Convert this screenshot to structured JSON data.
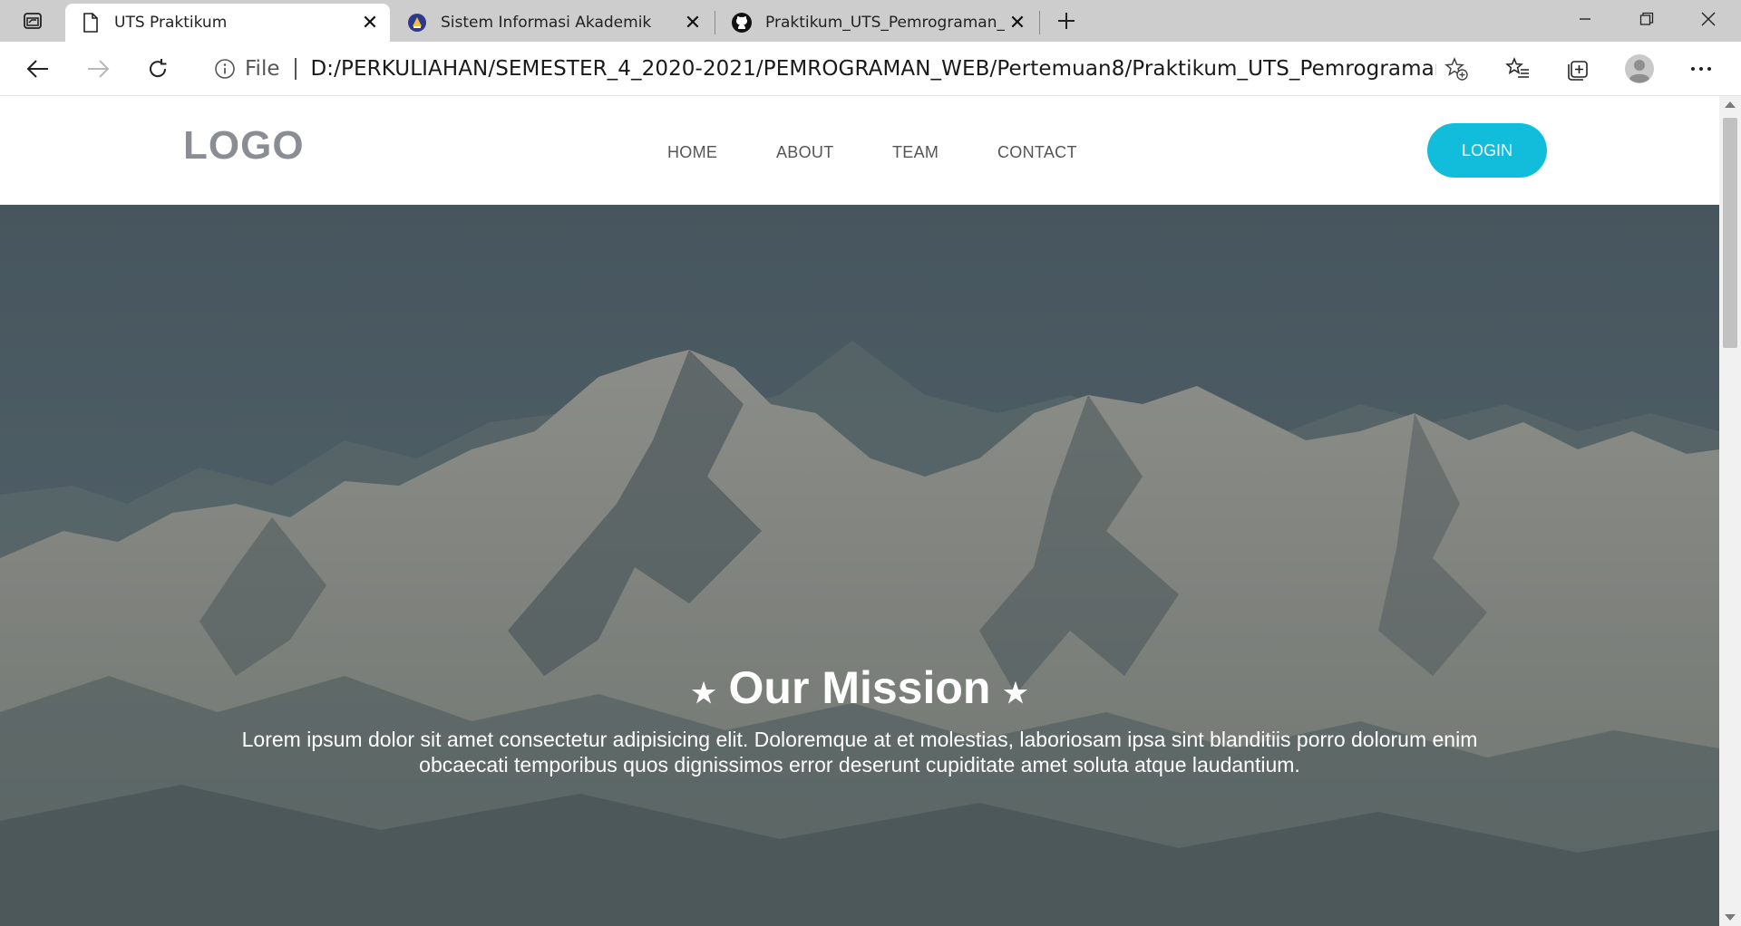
{
  "browser": {
    "tabs": [
      {
        "title": "UTS Praktikum",
        "active": true,
        "icon": "page-icon"
      },
      {
        "title": "Sistem Informasi Akademik",
        "active": false,
        "icon": "university-crest-icon"
      },
      {
        "title": "Praktikum_UTS_Pemrograman_W",
        "active": false,
        "icon": "github-icon"
      }
    ],
    "address": {
      "scheme": "File",
      "url": "D:/PERKULIAHAN/SEMESTER_4_2020-2021/PEMROGRAMAN_WEB/Pertemuan8/Praktikum_UTS_Pemrograman_W..."
    }
  },
  "page": {
    "logo": "LOGO",
    "nav": {
      "home": "HOME",
      "about": "ABOUT",
      "team": "TEAM",
      "contact": "CONTACT"
    },
    "login_label": "LOGIN",
    "hero": {
      "title": "Our Mission",
      "star": "★",
      "text": "Lorem ipsum dolor sit amet consectetur adipisicing elit. Doloremque at et molestias, laboriosam ipsa sint blanditiis porro dolorum enim obcaecati temporibus quos dignissimos error deserunt cupiditate amet soluta atque laudantium."
    }
  },
  "colors": {
    "accent": "#12bcdb",
    "hero_overlay": "#4a5b63",
    "logo": "#8b8d95"
  }
}
